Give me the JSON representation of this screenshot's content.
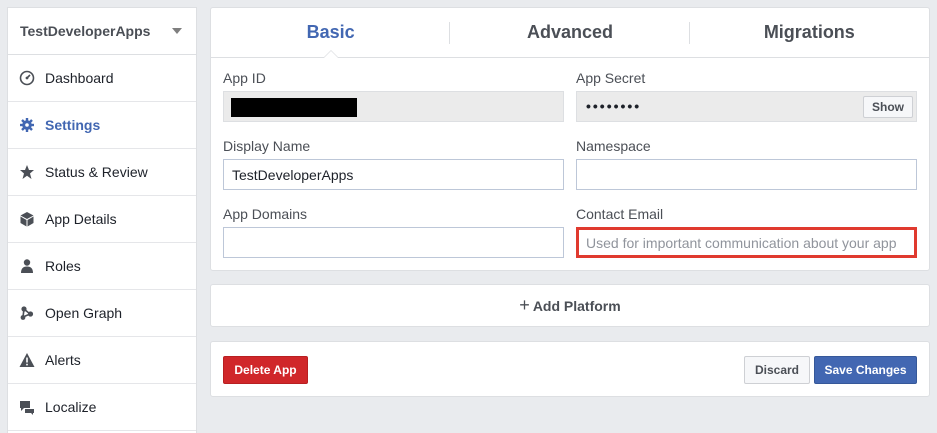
{
  "sidebar": {
    "app_name": "TestDeveloperApps",
    "items": [
      {
        "label": "Dashboard",
        "icon": "dashboard-icon"
      },
      {
        "label": "Settings",
        "icon": "gear-icon"
      },
      {
        "label": "Status & Review",
        "icon": "star-icon"
      },
      {
        "label": "App Details",
        "icon": "cube-icon"
      },
      {
        "label": "Roles",
        "icon": "person-icon"
      },
      {
        "label": "Open Graph",
        "icon": "graph-icon"
      },
      {
        "label": "Alerts",
        "icon": "warning-icon"
      },
      {
        "label": "Localize",
        "icon": "localize-icon"
      }
    ],
    "active_index": 1
  },
  "tabs": [
    {
      "label": "Basic"
    },
    {
      "label": "Advanced"
    },
    {
      "label": "Migrations"
    }
  ],
  "fields": {
    "app_id": {
      "label": "App ID",
      "value": ""
    },
    "app_secret": {
      "label": "App Secret",
      "value": "••••••••",
      "show_label": "Show"
    },
    "display_name": {
      "label": "Display Name",
      "value": "TestDeveloperApps"
    },
    "namespace": {
      "label": "Namespace",
      "value": ""
    },
    "app_domains": {
      "label": "App Domains",
      "value": ""
    },
    "contact_email": {
      "label": "Contact Email",
      "value": "",
      "placeholder": "Used for important communication about your app"
    }
  },
  "add_platform": {
    "label": "Add Platform"
  },
  "footer": {
    "delete_label": "Delete App",
    "discard_label": "Discard",
    "save_label": "Save Changes"
  },
  "colors": {
    "accent": "#4267b2",
    "danger": "#d0272a",
    "highlight": "#e03a2f"
  }
}
